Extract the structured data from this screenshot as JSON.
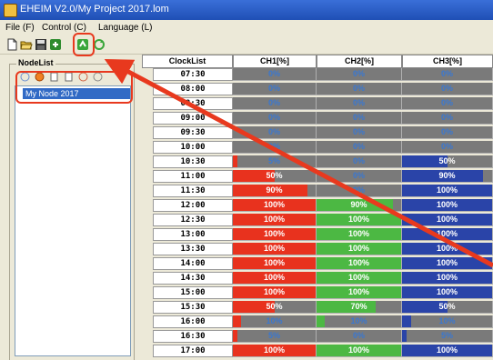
{
  "window": {
    "title": "EHEIM V2.0/My Project 2017.lom"
  },
  "menu": {
    "items": [
      "File (F)",
      "Control (C)",
      "Language (L)"
    ]
  },
  "toolbar": {
    "icons": [
      "new-file-icon",
      "open-folder-icon",
      "save-icon",
      "export-icon",
      "upload-icon",
      "refresh-icon"
    ]
  },
  "node_list": {
    "title": "NodeList",
    "items": [
      "My Node 2017"
    ]
  },
  "schedule": {
    "columns": [
      "ClockList",
      "CH1[%]",
      "CH2[%]",
      "CH3[%]"
    ],
    "colors": {
      "ch1": "#e8321e",
      "ch2": "#4cb843",
      "ch3": "#2a44a8",
      "empty": "#7a7a7a"
    },
    "rows": [
      {
        "time": "07:30",
        "ch1": "0%",
        "ch2": "0%",
        "ch3": "0%",
        "v": [
          0,
          0,
          0
        ]
      },
      {
        "time": "08:00",
        "ch1": "0%",
        "ch2": "0%",
        "ch3": "0%",
        "v": [
          0,
          0,
          0
        ]
      },
      {
        "time": "08:30",
        "ch1": "0%",
        "ch2": "0%",
        "ch3": "0%",
        "v": [
          0,
          0,
          0
        ]
      },
      {
        "time": "09:00",
        "ch1": "0%",
        "ch2": "0%",
        "ch3": "0%",
        "v": [
          0,
          0,
          0
        ]
      },
      {
        "time": "09:30",
        "ch1": "0%",
        "ch2": "0%",
        "ch3": "0%",
        "v": [
          0,
          0,
          0
        ]
      },
      {
        "time": "10:00",
        "ch1": "0%",
        "ch2": "0%",
        "ch3": "0%",
        "v": [
          0,
          0,
          0
        ]
      },
      {
        "time": "10:30",
        "ch1": "5%",
        "ch2": "0%",
        "ch3": "50%",
        "v": [
          0.05,
          0,
          0.5
        ]
      },
      {
        "time": "11:00",
        "ch1": "50%",
        "ch2": "0%",
        "ch3": "90%",
        "v": [
          0.5,
          0,
          0.9
        ]
      },
      {
        "time": "11:30",
        "ch1": "90%",
        "ch2": "0%",
        "ch3": "100%",
        "v": [
          0.9,
          0,
          1
        ]
      },
      {
        "time": "12:00",
        "ch1": "100%",
        "ch2": "90%",
        "ch3": "100%",
        "v": [
          1,
          0.9,
          1
        ]
      },
      {
        "time": "12:30",
        "ch1": "100%",
        "ch2": "100%",
        "ch3": "100%",
        "v": [
          1,
          1,
          1
        ]
      },
      {
        "time": "13:00",
        "ch1": "100%",
        "ch2": "100%",
        "ch3": "100%",
        "v": [
          1,
          1,
          1
        ]
      },
      {
        "time": "13:30",
        "ch1": "100%",
        "ch2": "100%",
        "ch3": "100%",
        "v": [
          1,
          1,
          1
        ]
      },
      {
        "time": "14:00",
        "ch1": "100%",
        "ch2": "100%",
        "ch3": "100%",
        "v": [
          1,
          1,
          1
        ]
      },
      {
        "time": "14:30",
        "ch1": "100%",
        "ch2": "100%",
        "ch3": "100%",
        "v": [
          1,
          1,
          1
        ]
      },
      {
        "time": "15:00",
        "ch1": "100%",
        "ch2": "100%",
        "ch3": "100%",
        "v": [
          1,
          1,
          1
        ]
      },
      {
        "time": "15:30",
        "ch1": "50%",
        "ch2": "70%",
        "ch3": "50%",
        "v": [
          0.5,
          0.7,
          0.5
        ]
      },
      {
        "time": "16:00",
        "ch1": "10%",
        "ch2": "10%",
        "ch3": "10%",
        "v": [
          0.1,
          0.1,
          0.1
        ]
      },
      {
        "time": "16:30",
        "ch1": "5%",
        "ch2": "0%",
        "ch3": "5%",
        "v": [
          0.05,
          0,
          0.05
        ]
      },
      {
        "time": "17:00",
        "ch1": "100%",
        "ch2": "100%",
        "ch3": "100%",
        "v": [
          1,
          1,
          1
        ]
      }
    ]
  }
}
